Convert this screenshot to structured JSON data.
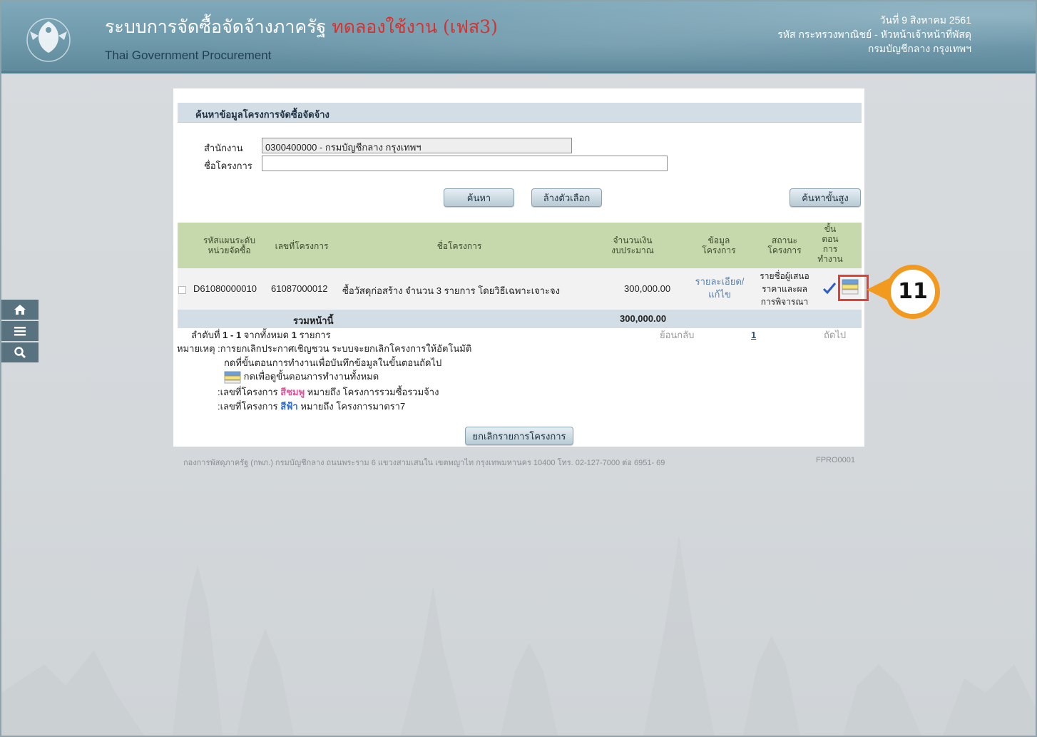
{
  "header": {
    "title_main": "ระบบการจัดซื้อจัดจ้างภาครัฐ",
    "title_trial": "ทดลองใช้งาน (เฟส3)",
    "title_sub": "Thai Government Procurement",
    "date": "วันที่ 9 สิงหาคม 2561",
    "user_line": "รหัส กระทรวงพาณิชย์ - หัวหน้าเจ้าหน้าที่พัสดุ",
    "org_line": "กรมบัญชีกลาง กรุงเทพฯ"
  },
  "side_tools": [
    {
      "icon": "home-icon"
    },
    {
      "icon": "menu-icon"
    },
    {
      "icon": "search-icon"
    }
  ],
  "search": {
    "panel_title": "ค้นหาข้อมูลโครงการจัดซื้อจัดจ้าง",
    "office_label": "สำนักงาน",
    "office_value": "0300400000 - กรมบัญชีกลาง กรุงเทพฯ",
    "project_label": "ชื่อโครงการ",
    "project_value": "",
    "search_button": "ค้นหา",
    "clear_button": "ล้างตัวเลือก",
    "advanced_button": "ค้นหาขั้นสูง"
  },
  "table": {
    "headers": {
      "plan_code_1": "รหัสแผนระดับ",
      "plan_code_2": "หน่วยจัดซื้อ",
      "project_no": "เลขที่โครงการ",
      "project_name": "ชื่อโครงการ",
      "budget_1": "จำนวนเงิน",
      "budget_2": "งบประมาณ",
      "info_1": "ข้อมูล",
      "info_2": "โครงการ",
      "status_1": "สถานะ",
      "status_2": "โครงการ",
      "step_1": "ขั้น",
      "step_2": "ตอน",
      "step_3": "การ",
      "step_4": "ทำงาน"
    },
    "row": {
      "plan_code": "D61080000010",
      "project_no": "61087000012",
      "project_name": "ซื้อวัสดุก่อสร้าง จำนวน 3 รายการ โดยวิธีเฉพาะเจาะจง",
      "budget": "300,000.00",
      "info_link_1": "รายละเอียด/",
      "info_link_2": "แก้ไข",
      "status_1": "รายชื่อผู้เสนอ",
      "status_2": "ราคาและผล",
      "status_3": "การพิจารณา"
    },
    "total_label": "รวมหน้านี้",
    "total_value": "300,000.00"
  },
  "pagination": {
    "summary_prefix": "ลำดับที่",
    "summary_range": "1 - 1",
    "summary_middle": "จากทั้งหมด",
    "summary_count": "1",
    "summary_suffix": "รายการ",
    "prev": "ย้อนกลับ",
    "page": "1",
    "next": "ถัดไป"
  },
  "notes": {
    "remark_label": "หมายเหตุ :",
    "remark_text": "การยกเลิกประกาศเชิญชวน ระบบจะยกเลิกโครงการให้อัตโนมัติ",
    "step_hint": "กดที่ขั้นตอนการทำงานเพื่อบันทึกข้อมูลในขั้นตอนถัดไป",
    "all_steps_hint": "กดเพื่อดูขั้นตอนการทำงานทั้งหมด",
    "pink_prefix": ":เลขที่โครงการ",
    "pink_word": "สีชมพู",
    "pink_suffix": "หมายถึง โครงการรวมซื้อรวมจ้าง",
    "blue_prefix": ":เลขที่โครงการ",
    "blue_word": "สีฟ้า",
    "blue_suffix": "หมายถึง โครงการมาตรา7"
  },
  "cancel_button": "ยกเลิกรายการโครงการ",
  "footer": {
    "address": "กองการพัสดุภาครัฐ (กพภ.) กรมบัญชีกลาง ถนนพระราม 6 แขวงสามเสนใน เขตพญาไท กรุงเทพมหานคร 10400 โทร. 02-127-7000 ต่อ 6951- 69",
    "code": "FPRO0001"
  },
  "annotation": {
    "step_number": "11",
    "color": "#f29a1f",
    "box_color": "#e23f35"
  }
}
